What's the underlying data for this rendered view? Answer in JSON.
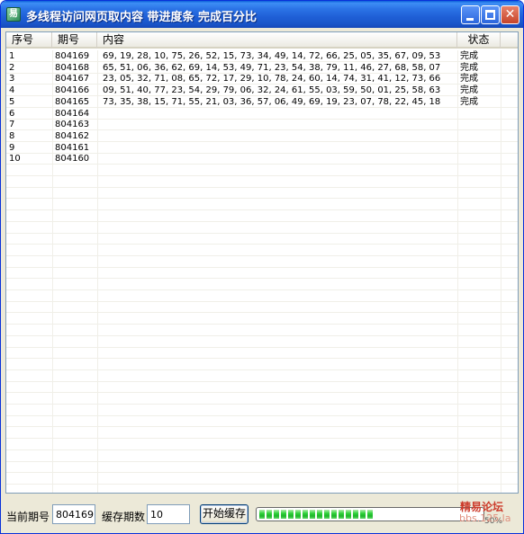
{
  "window": {
    "title": "多线程访问网页取内容  带进度条  完成百分比",
    "app_icon": "易",
    "close_glyph": "✕"
  },
  "table": {
    "columns": [
      "序号",
      "期号",
      "内容",
      "状态"
    ],
    "rows": [
      {
        "index": "1",
        "issue": "804169",
        "content": "69, 19, 28, 10, 75, 26, 52, 15, 73, 34, 49, 14, 72, 66, 25, 05, 35, 67, 09, 53",
        "status": "完成"
      },
      {
        "index": "2",
        "issue": "804168",
        "content": "65, 51, 06, 36, 62, 69, 14, 53, 49, 71, 23, 54, 38, 79, 11, 46, 27, 68, 58, 07",
        "status": "完成"
      },
      {
        "index": "3",
        "issue": "804167",
        "content": "23, 05, 32, 71, 08, 65, 72, 17, 29, 10, 78, 24, 60, 14, 74, 31, 41, 12, 73, 66",
        "status": "完成"
      },
      {
        "index": "4",
        "issue": "804166",
        "content": "09, 51, 40, 77, 23, 54, 29, 79, 06, 32, 24, 61, 55, 03, 59, 50, 01, 25, 58, 63",
        "status": "完成"
      },
      {
        "index": "5",
        "issue": "804165",
        "content": "73, 35, 38, 15, 71, 55, 21, 03, 36, 57, 06, 49, 69, 19, 23, 07, 78, 22, 45, 18",
        "status": "完成"
      },
      {
        "index": "6",
        "issue": "804164",
        "content": "",
        "status": ""
      },
      {
        "index": "7",
        "issue": "804163",
        "content": "",
        "status": ""
      },
      {
        "index": "8",
        "issue": "804162",
        "content": "",
        "status": ""
      },
      {
        "index": "9",
        "issue": "804161",
        "content": "",
        "status": ""
      },
      {
        "index": "10",
        "issue": "804160",
        "content": "",
        "status": ""
      }
    ]
  },
  "controls": {
    "current_issue_label": "当前期号",
    "current_issue_value": "804169",
    "cache_count_label": "缓存期数",
    "cache_count_value": "10",
    "start_button_label": "开始缓存",
    "progress_fraction": 0.5,
    "progress_percent_text": "50%"
  },
  "watermark": {
    "line1": "精易论坛",
    "line2": "bbs.125.la"
  },
  "colors": {
    "title_bar": "#2b73e6",
    "progress_green": "#2fd23a",
    "watermark_red": "#cc3b2b"
  }
}
